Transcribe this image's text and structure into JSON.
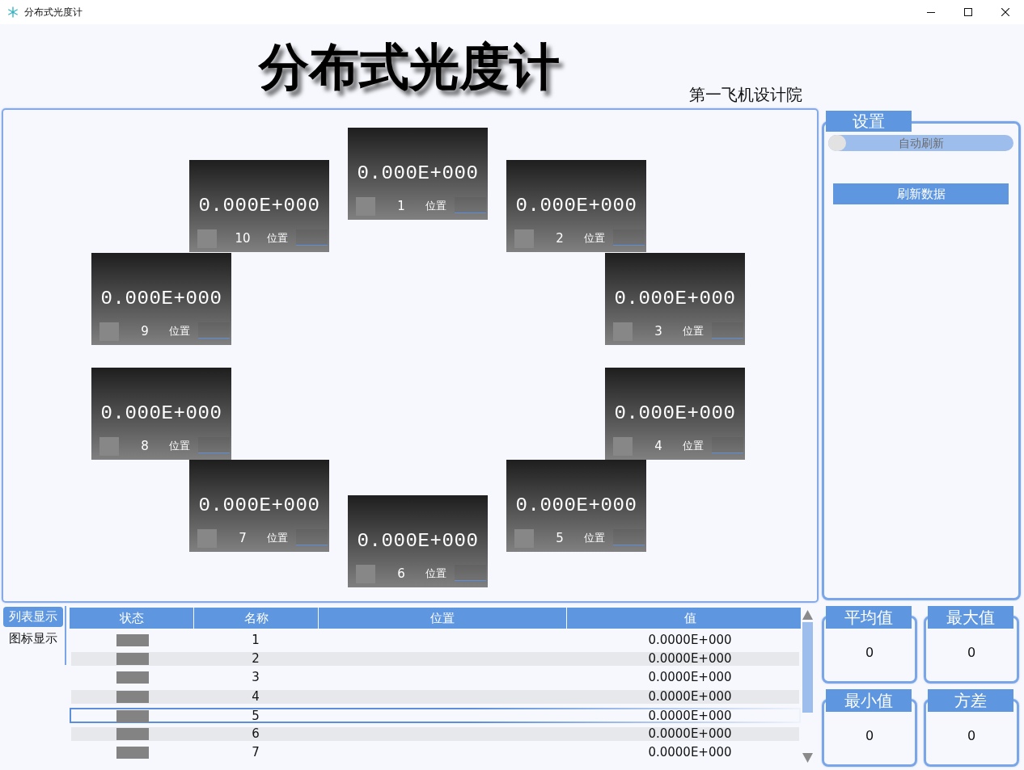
{
  "window": {
    "title": "分布式光度计"
  },
  "header": {
    "title": "分布式光度计",
    "subtitle": "第一飞机设计院"
  },
  "meters": [
    {
      "reading": "0.000E+000",
      "number": "1",
      "position_label": "位置"
    },
    {
      "reading": "0.000E+000",
      "number": "10",
      "position_label": "位置"
    },
    {
      "reading": "0.000E+000",
      "number": "2",
      "position_label": "位置"
    },
    {
      "reading": "0.000E+000",
      "number": "9",
      "position_label": "位置"
    },
    {
      "reading": "0.000E+000",
      "number": "3",
      "position_label": "位置"
    },
    {
      "reading": "0.000E+000",
      "number": "8",
      "position_label": "位置"
    },
    {
      "reading": "0.000E+000",
      "number": "4",
      "position_label": "位置"
    },
    {
      "reading": "0.000E+000",
      "number": "7",
      "position_label": "位置"
    },
    {
      "reading": "0.000E+000",
      "number": "5",
      "position_label": "位置"
    },
    {
      "reading": "0.000E+000",
      "number": "6",
      "position_label": "位置"
    }
  ],
  "settings": {
    "title": "设置",
    "auto_refresh": {
      "label": "自动刷新",
      "on": false
    },
    "refresh_button": "刷新数据"
  },
  "view_tabs": [
    {
      "label": "列表显示",
      "selected": true
    },
    {
      "label": "图标显示",
      "selected": false
    }
  ],
  "table": {
    "columns": [
      "状态",
      "名称",
      "位置",
      "值"
    ],
    "rows": [
      {
        "name": "1",
        "value": "0.0000E+000",
        "selected": false
      },
      {
        "name": "2",
        "value": "0.0000E+000",
        "selected": false
      },
      {
        "name": "3",
        "value": "0.0000E+000",
        "selected": false
      },
      {
        "name": "4",
        "value": "0.0000E+000",
        "selected": false
      },
      {
        "name": "5",
        "value": "0.0000E+000",
        "selected": true
      },
      {
        "name": "6",
        "value": "0.0000E+000",
        "selected": false
      },
      {
        "name": "7",
        "value": "0.0000E+000",
        "selected": false
      }
    ]
  },
  "stats": [
    {
      "label": "平均值",
      "value": "0"
    },
    {
      "label": "最大值",
      "value": "0"
    },
    {
      "label": "最小值",
      "value": "0"
    },
    {
      "label": "方差",
      "value": "0"
    }
  ]
}
